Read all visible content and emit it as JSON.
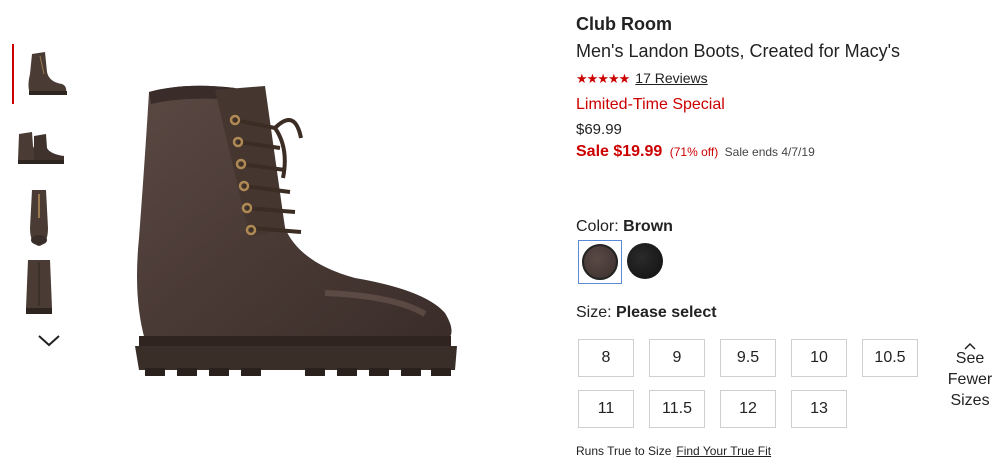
{
  "product": {
    "brand": "Club Room",
    "name": "Men's Landon Boots, Created for Macy's",
    "stars": "★★★★★",
    "reviews": "17 Reviews",
    "promo": "Limited-Time Special",
    "original_price": "$69.99",
    "sale_price": "Sale $19.99",
    "discount": "(71% off)",
    "sale_ends": "Sale ends 4/7/19"
  },
  "color": {
    "label": "Color:",
    "selected": "Brown",
    "options": [
      "Brown",
      "Black"
    ]
  },
  "size": {
    "label": "Size:",
    "selected": "Please select",
    "options": [
      "8",
      "9",
      "9.5",
      "10",
      "10.5",
      "11",
      "11.5",
      "12",
      "13"
    ],
    "toggle_lines": [
      "See",
      "Fewer",
      "Sizes"
    ]
  },
  "fit": {
    "text": "Runs True to Size",
    "link": "Find Your True Fit"
  },
  "colors": {
    "accent": "#cc0000",
    "selected_border": "#5b8ad6"
  },
  "icons": {
    "thumbnails_next": "chevron-down-icon",
    "sizes_toggle": "chevron-up-icon"
  }
}
